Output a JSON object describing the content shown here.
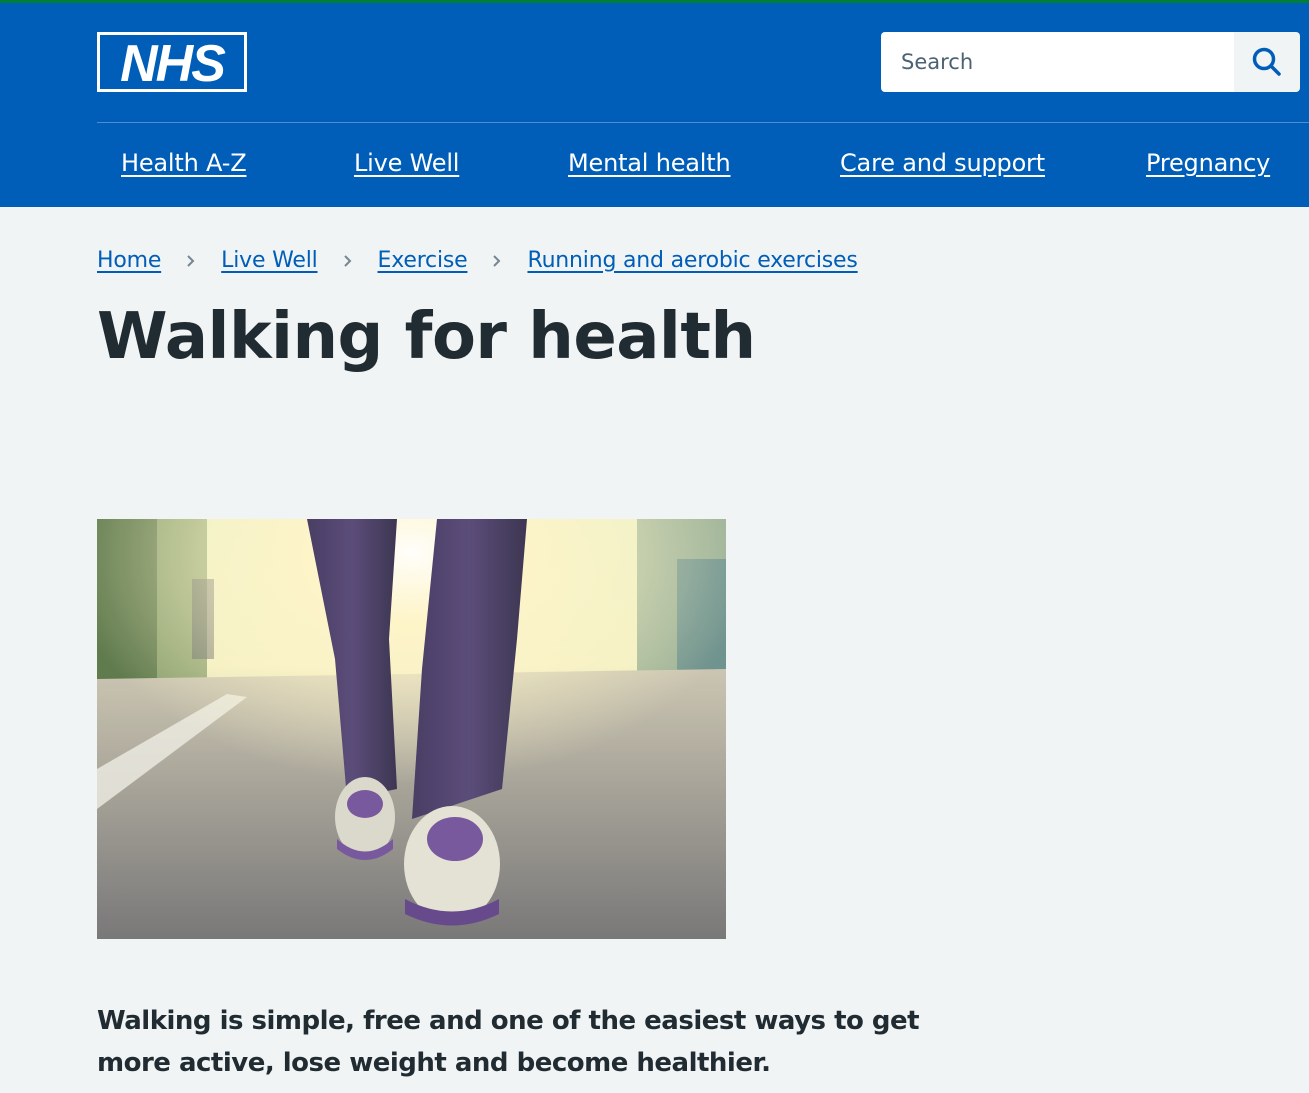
{
  "header": {
    "logo_text": "NHS",
    "search": {
      "placeholder": "Search",
      "button_icon": "search-icon"
    },
    "nav": [
      {
        "label": "Health A-Z"
      },
      {
        "label": "Live Well"
      },
      {
        "label": "Mental health"
      },
      {
        "label": "Care and support"
      },
      {
        "label": "Pregnancy"
      }
    ]
  },
  "breadcrumb": [
    {
      "label": "Home"
    },
    {
      "label": "Live Well"
    },
    {
      "label": "Exercise"
    },
    {
      "label": "Running and aerobic exercises"
    }
  ],
  "breadcrumb_separator_icon": "chevron-right-icon",
  "page": {
    "title": "Walking for health",
    "lede": "Walking is simple, free and one of the easiest ways to get more active, lose weight and become healthier."
  },
  "colors": {
    "nhs_blue": "#005eb8",
    "page_background": "#f0f4f5",
    "text": "#212b32",
    "top_stripe": "#007f3b"
  }
}
